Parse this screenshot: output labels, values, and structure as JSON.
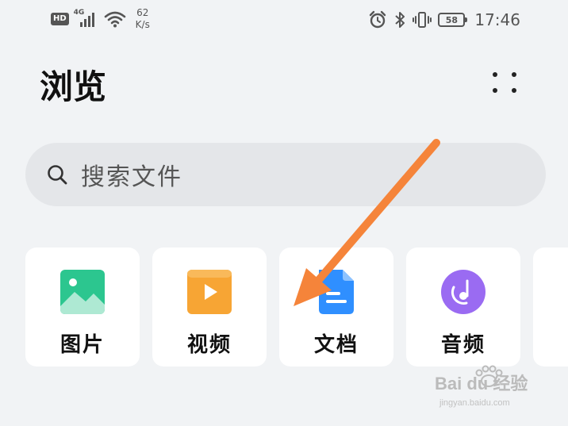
{
  "status_bar": {
    "hd_badge": "HD",
    "network_type": "4G",
    "speed_value": "62",
    "speed_unit": "K/s",
    "battery_level": "58",
    "time": "17:46",
    "icons": [
      "signal-icon",
      "wifi-icon",
      "alarm-icon",
      "bluetooth-icon",
      "vibrate-icon",
      "battery-icon"
    ]
  },
  "header": {
    "title": "浏览",
    "more_icon": "more-dots-icon"
  },
  "search": {
    "placeholder": "搜索文件",
    "icon": "search-icon"
  },
  "categories": [
    {
      "label": "图片",
      "icon": "image-icon",
      "color": "#2cc68f"
    },
    {
      "label": "视频",
      "icon": "video-icon",
      "color": "#f7a534"
    },
    {
      "label": "文档",
      "icon": "document-icon",
      "color": "#2f8fff"
    },
    {
      "label": "音频",
      "icon": "audio-icon",
      "color": "#9a6bf2"
    }
  ],
  "annotation": {
    "arrow_color": "#f5843a"
  },
  "watermark": {
    "main": "Bai du 经验",
    "sub": "jingyan.baidu.com"
  }
}
